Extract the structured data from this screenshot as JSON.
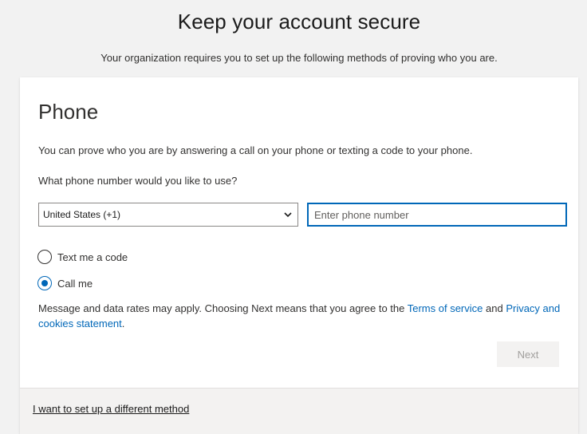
{
  "page": {
    "title": "Keep your account secure",
    "subtitle": "Your organization requires you to set up the following methods of proving who you are."
  },
  "card": {
    "heading": "Phone",
    "description": "You can prove who you are by answering a call on your phone or texting a code to your phone.",
    "question": "What phone number would you like to use?",
    "country_select": {
      "selected": "United States (+1)",
      "icon": "chevron-down-icon"
    },
    "phone_input": {
      "value": "",
      "placeholder": "Enter phone number"
    },
    "options": [
      {
        "label": "Text me a code",
        "checked": false
      },
      {
        "label": "Call me",
        "checked": true
      }
    ],
    "disclaimer": {
      "text_before": "Message and data rates may apply. Choosing Next means that you agree to the ",
      "terms_link": "Terms of service",
      "text_middle": " and ",
      "privacy_link": "Privacy and cookies statement",
      "text_after": "."
    },
    "next_button": {
      "label": "Next",
      "disabled": true
    }
  },
  "footer": {
    "different_method_link": "I want to set up a different method"
  },
  "colors": {
    "accent": "#0067b8",
    "page_background": "#f2f2f2",
    "disabled_text": "#a19f9d"
  }
}
